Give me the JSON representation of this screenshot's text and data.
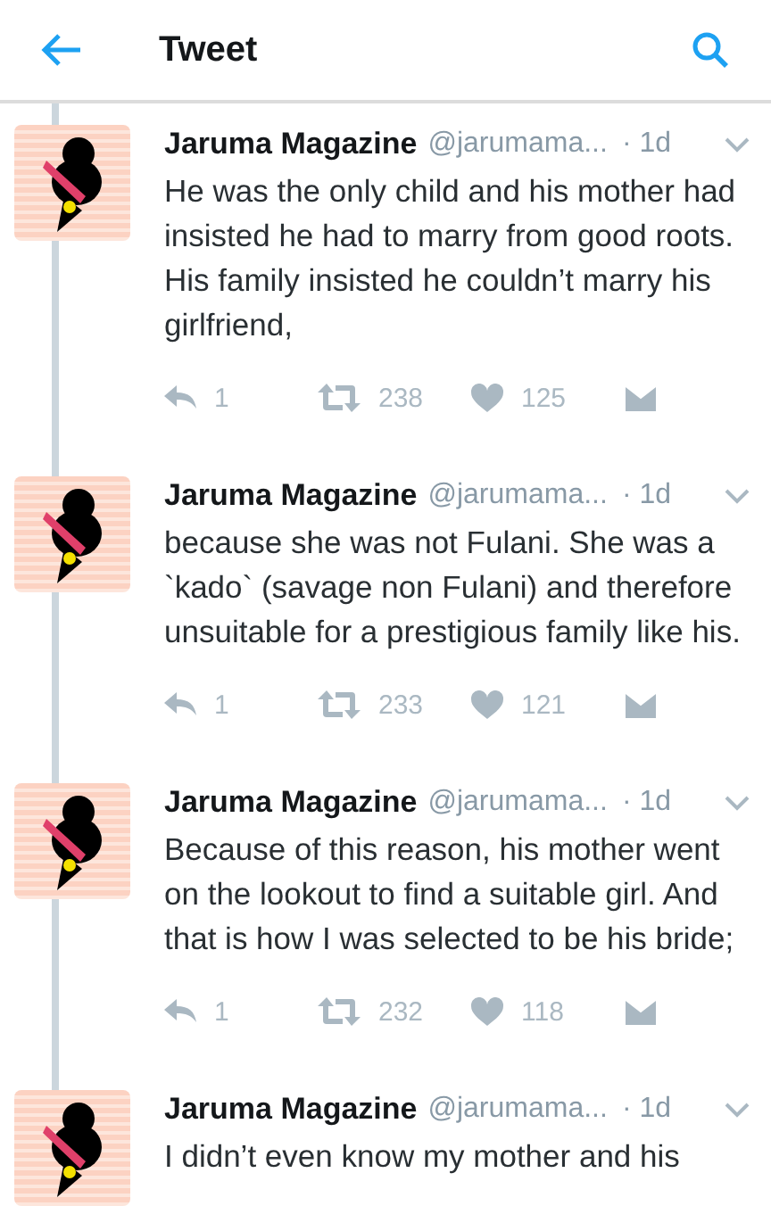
{
  "header": {
    "title": "Tweet"
  },
  "tweets": [
    {
      "name": "Jaruma Magazine",
      "handle": "@jarumama...",
      "time": "· 1d",
      "text": "He was the only child and his mother had insisted he had to marry from good roots. His family insisted he couldn’t marry his girlfriend,",
      "replies": "1",
      "retweets": "238",
      "likes": "125"
    },
    {
      "name": "Jaruma Magazine",
      "handle": "@jarumama...",
      "time": "· 1d",
      "text": "because she was not Fulani. She was a `kado` (savage non Fulani) and therefore unsuitable for a prestigious family like his.",
      "replies": "1",
      "retweets": "233",
      "likes": "121"
    },
    {
      "name": "Jaruma Magazine",
      "handle": "@jarumama...",
      "time": "· 1d",
      "text": "Because of this reason, his mother went on the lookout to find a suitable girl. And that is how I was selected to be his bride;",
      "replies": "1",
      "retweets": "232",
      "likes": "118"
    },
    {
      "name": "Jaruma Magazine",
      "handle": "@jarumama...",
      "time": "· 1d",
      "text": "I didn’t even know my mother and his"
    }
  ]
}
